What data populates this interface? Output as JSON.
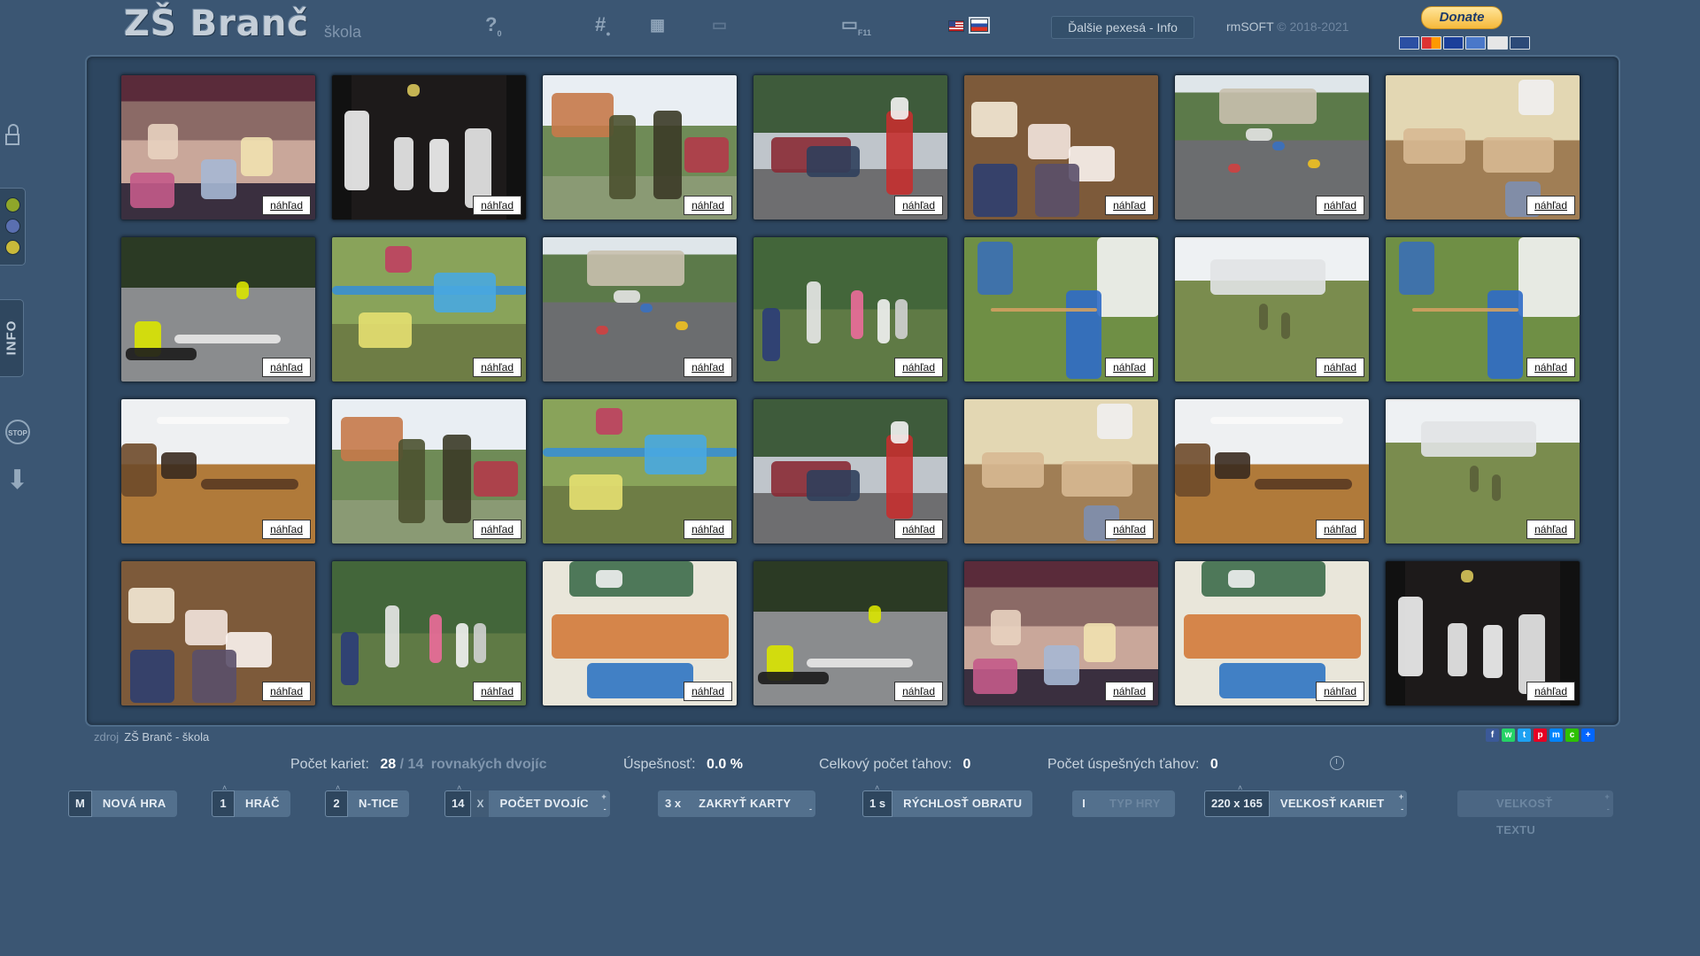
{
  "header": {
    "logo": "ZŠ Branč",
    "subtitle": "škola",
    "help_label": "?",
    "help_count": "0",
    "hash_label": "#",
    "fullscreen_label": "F11",
    "info_button": "Ďalšie pexesá - Info",
    "copyright_brand": "rmSOFT",
    "copyright_years": "© 2018-2021",
    "donate": "Donate"
  },
  "sidebar": {
    "info_label": "INFO",
    "stop_label": "STOP"
  },
  "board": {
    "preview_label": "náhľad",
    "cards": [
      {
        "scene": "audience"
      },
      {
        "scene": "stage"
      },
      {
        "scene": "falconry"
      },
      {
        "scene": "santa"
      },
      {
        "scene": "diploma"
      },
      {
        "scene": "cars"
      },
      {
        "scene": "classroom"
      },
      {
        "scene": "bikes"
      },
      {
        "scene": "climbing"
      },
      {
        "scene": "cars"
      },
      {
        "scene": "park"
      },
      {
        "scene": "archery"
      },
      {
        "scene": "soccer"
      },
      {
        "scene": "archery"
      },
      {
        "scene": "library"
      },
      {
        "scene": "falconry"
      },
      {
        "scene": "climbing"
      },
      {
        "scene": "santa"
      },
      {
        "scene": "classroom"
      },
      {
        "scene": "library"
      },
      {
        "scene": "soccer"
      },
      {
        "scene": "diploma"
      },
      {
        "scene": "park"
      },
      {
        "scene": "group"
      },
      {
        "scene": "bikes"
      },
      {
        "scene": "audience"
      },
      {
        "scene": "group"
      },
      {
        "scene": "stage"
      }
    ]
  },
  "footer": {
    "source_label": "zdroj",
    "source_value": "ZŠ Branč - škola",
    "cards_label": "Počet kariet:",
    "cards_value": "28",
    "pairs_sep": "/",
    "pairs_value": "14",
    "pairs_label": "rovnakých dvojíc",
    "success_label": "Úspešnosť:",
    "success_value": "0.0 %",
    "moves_label": "Celkový počet ťahov:",
    "moves_value": "0",
    "good_moves_label": "Počet úspešných ťahov:",
    "good_moves_value": "0"
  },
  "controls": {
    "new_game": {
      "key": "M",
      "label": "NOVÁ HRA"
    },
    "player": {
      "key": "1",
      "label": "HRÁČ"
    },
    "ntice": {
      "key": "2",
      "label": "N-TICE"
    },
    "pairs": {
      "key": "14",
      "x": "X",
      "label": "POČET DVOJÍC"
    },
    "cover": {
      "key": "3 x",
      "label": "ZAKRYŤ KARTY"
    },
    "speed": {
      "key": "1 s",
      "label": "RÝCHLOSŤ OBRATU"
    },
    "game_type": {
      "key": "I",
      "label": "TYP HRY"
    },
    "card_size": {
      "key": "220 x 165",
      "label": "VEĽKOSŤ KARIET"
    },
    "text_size": {
      "key": "",
      "label": "VEĽKOSŤ TEXTU"
    }
  },
  "colors": {
    "background": "#3b5673",
    "board": "#2d4660",
    "dot_green": "#8fa62a",
    "dot_blue": "#5a6fb0",
    "dot_yellow": "#c9b93a"
  }
}
